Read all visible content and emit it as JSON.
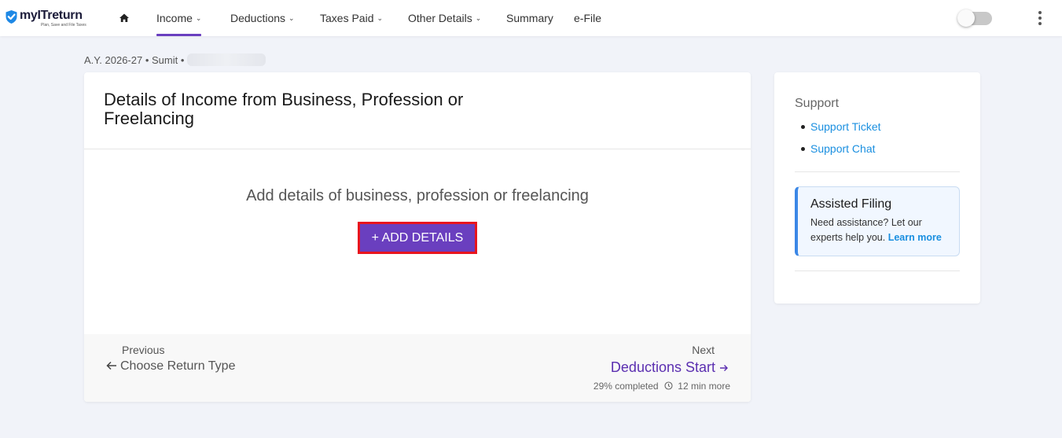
{
  "brand": {
    "name": "myITreturn",
    "tagline": "Plan, Save and File Taxes",
    "accent_color": "#6a3fbf",
    "shield_color": "#1e88e5"
  },
  "nav": {
    "home_icon": "home-icon",
    "items": [
      {
        "label": "Income",
        "has_dropdown": true,
        "active": true
      },
      {
        "label": "Deductions",
        "has_dropdown": true
      },
      {
        "label": "Taxes Paid",
        "has_dropdown": true
      },
      {
        "label": "Other Details",
        "has_dropdown": true
      },
      {
        "label": "Summary",
        "has_dropdown": false
      },
      {
        "label": "e-File",
        "has_dropdown": false
      }
    ],
    "chevron": "⌄"
  },
  "breadcrumb": {
    "text": "A.Y. 2026-27 • Sumit •"
  },
  "card": {
    "title": "Details of Income from Business, Profession or Freelancing",
    "message": "Add details of business, profession or freelancing",
    "add_button": "+ ADD DETAILS",
    "footer": {
      "previous_label": "Previous",
      "previous_link": "Choose Return Type",
      "next_label": "Next",
      "next_link": "Deductions Start",
      "progress_text": "29% completed",
      "time_text": "12 min more"
    }
  },
  "sidebar": {
    "support_title": "Support",
    "support_links": [
      "Support Ticket",
      "Support Chat"
    ],
    "assisted": {
      "title": "Assisted Filing",
      "text": "Need assistance? Let our experts help you.",
      "link": "Learn more"
    }
  }
}
